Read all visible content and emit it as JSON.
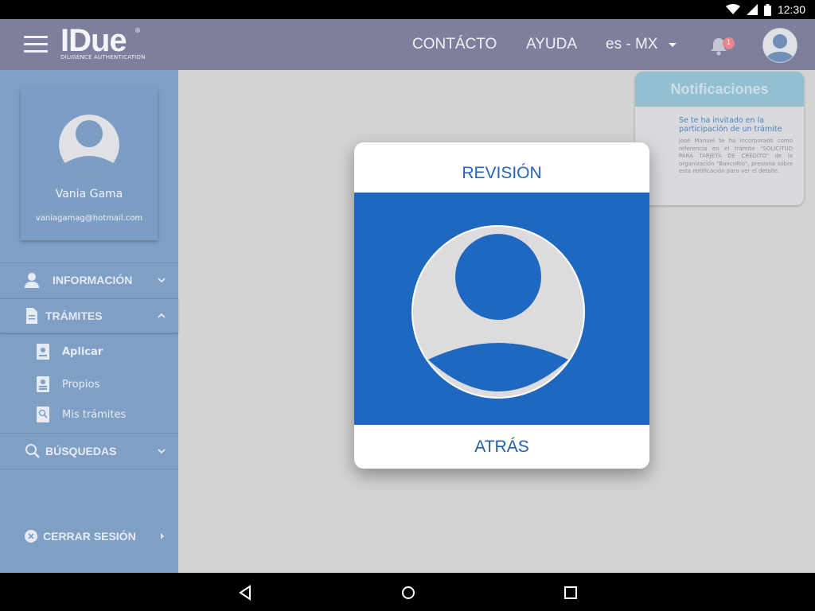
{
  "status_bar": {
    "time": "12:30"
  },
  "header": {
    "logo_text": "IDue",
    "logo_tagline": "DILIGENCE AUTHENTICATION",
    "logo_mark": "®",
    "nav_contacto": "CONTÁCTO",
    "nav_ayuda": "AYUDA",
    "language": "es - MX",
    "notification_count": "1"
  },
  "sidebar": {
    "user_name": "Vania Gama",
    "user_email": "vaniagamag@hotmail.com",
    "menu_informacion": "INFORMACIÓN",
    "menu_tramites": "TRÁMITES",
    "sub_aplicar": "Aplicar",
    "sub_propios": "Propios",
    "sub_mis_tramites": "Mis trámites",
    "menu_busquedas": "BÚSQUEDAS",
    "cerrar_sesion": "CERRAR SESIÓN"
  },
  "notifications": {
    "heading": "Notificaciones",
    "item_title": "Se te ha invitado en la participación de un trámite",
    "item_body": "José Manuel te ha incorporado como referencia en el trámite \"SOLICITUD PARA TARJETA DE CRÉDITO\" de la organización \"BancoRío\", presiona sobre esta notificación para ver el detalle."
  },
  "modal": {
    "title": "REVISIÓN",
    "back_label": "ATRÁS"
  },
  "colors": {
    "header_bg": "#7e7f9c",
    "sidebar_bg": "#7f9fc4",
    "modal_blue": "#1f68c0",
    "accent_text": "#2565bd",
    "badge": "#e8868e"
  }
}
